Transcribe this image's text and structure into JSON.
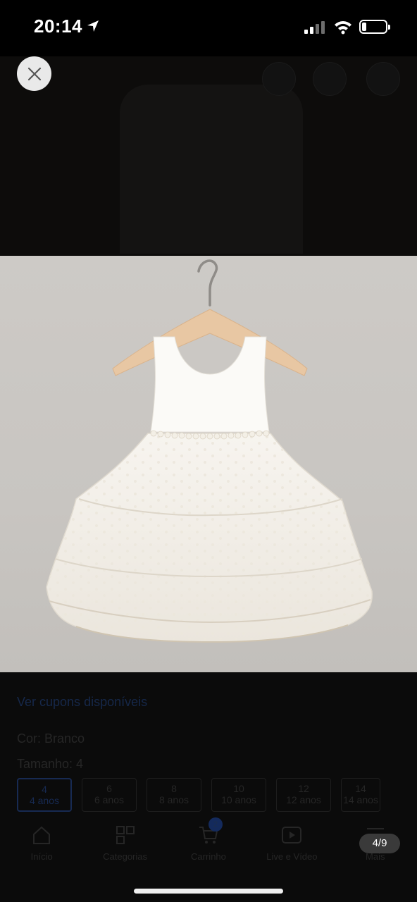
{
  "status_bar": {
    "time": "20:14"
  },
  "viewer": {
    "counter": "4/9"
  },
  "product": {
    "coupons_link": "Ver cupons disponíveis",
    "color_line": "Cor: Branco",
    "size_line": "Tamanho: 4",
    "sizes": [
      {
        "num": "4",
        "label": "4 anos"
      },
      {
        "num": "6",
        "label": "6 anos"
      },
      {
        "num": "8",
        "label": "8 anos"
      },
      {
        "num": "10",
        "label": "10 anos"
      },
      {
        "num": "12",
        "label": "12 anos"
      },
      {
        "num": "14",
        "label": "14 anos"
      }
    ]
  },
  "tabbar": {
    "items": [
      {
        "label": "Início",
        "icon": "home-icon"
      },
      {
        "label": "Categorias",
        "icon": "grid-icon"
      },
      {
        "label": "Carrinho",
        "icon": "cart-icon"
      },
      {
        "label": "Live e Vídeo",
        "icon": "play-icon"
      },
      {
        "label": "Mais",
        "icon": "menu-icon"
      }
    ],
    "cart_badge": "2"
  },
  "colors": {
    "accent": "#142a5c",
    "photo_bg": "#c9c6c2",
    "dress": "#f8f6f2"
  }
}
